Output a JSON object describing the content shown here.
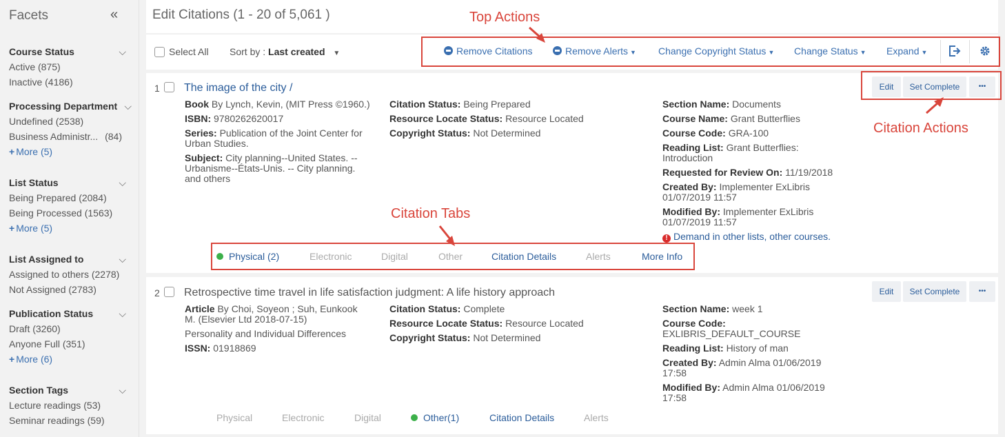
{
  "sidebar": {
    "title": "Facets",
    "facets": [
      {
        "title": "Course Status",
        "items": [
          {
            "label": "Active",
            "count": "(875)"
          },
          {
            "label": "Inactive",
            "count": "(4186)"
          }
        ]
      },
      {
        "title": "Processing Department",
        "items": [
          {
            "label": "Undefined",
            "count": "(2538)"
          },
          {
            "label": "Business Administr...",
            "count": "(84)"
          }
        ],
        "more": "More (5)"
      },
      {
        "title": "List Status",
        "items": [
          {
            "label": "Being Prepared",
            "count": "(2084)"
          },
          {
            "label": "Being Processed",
            "count": "(1563)"
          }
        ],
        "more": "More (5)"
      },
      {
        "title": "List Assigned to",
        "items": [
          {
            "label": "Assigned to others",
            "count": "(2278)"
          },
          {
            "label": "Not Assigned",
            "count": "(2783)"
          }
        ]
      },
      {
        "title": "Publication Status",
        "items": [
          {
            "label": "Draft",
            "count": "(3260)"
          },
          {
            "label": "Anyone Full",
            "count": "(351)"
          }
        ],
        "more": "More (6)"
      },
      {
        "title": "Section Tags",
        "items": [
          {
            "label": "Lecture readings",
            "count": "(53)"
          },
          {
            "label": "Seminar readings",
            "count": "(59)"
          }
        ]
      }
    ]
  },
  "header": {
    "title": "Edit Citations (1 - 20 of 5,061 )"
  },
  "toolbar": {
    "select_all": "Select All",
    "sort_prefix": "Sort by :",
    "sort_value": "Last created",
    "actions": {
      "remove_citations": "Remove Citations",
      "remove_alerts": "Remove Alerts",
      "change_copyright": "Change Copyright Status",
      "change_status": "Change Status",
      "expand": "Expand"
    }
  },
  "annotations": {
    "top_actions": "Top Actions",
    "citation_actions": "Citation Actions",
    "citation_tabs": "Citation Tabs"
  },
  "citations": [
    {
      "num": "1",
      "title": "The image of the city /",
      "left": {
        "type": "Book",
        "by": "By Lynch, Kevin, (MIT Press ©1960.)",
        "isbn_label": "ISBN:",
        "isbn": "9780262620017",
        "series_label": "Series:",
        "series": "Publication of the Joint Center for Urban Studies.",
        "subject_label": "Subject:",
        "subject": "City planning--United States. -- Urbanisme--États-Unis. -- City planning.",
        "others": "and others"
      },
      "middle": {
        "status_label": "Citation Status:",
        "status": "Being Prepared",
        "rls_label": "Resource Locate Status:",
        "rls": "Resource Located",
        "copyright_label": "Copyright Status:",
        "copyright": "Not Determined"
      },
      "right": {
        "section_label": "Section Name:",
        "section": "Documents",
        "course_label": "Course Name:",
        "course": "Grant Butterflies",
        "code_label": "Course Code:",
        "code": "GRA-100",
        "list_label": "Reading List:",
        "list": "Grant Butterflies: Introduction",
        "review_label": "Requested for Review On:",
        "review": "11/19/2018",
        "created_label": "Created By:",
        "created": "Implementer ExLibris 01/07/2019 11:57",
        "modified_label": "Modified By:",
        "modified": "Implementer ExLibris 01/07/2019 11:57",
        "demand": "Demand in other lists, other courses."
      },
      "buttons": {
        "edit": "Edit",
        "complete": "Set Complete",
        "more": "•••"
      },
      "tabs": [
        "Physical (2)",
        "Electronic",
        "Digital",
        "Other",
        "Citation Details",
        "Alerts",
        "More Info"
      ]
    },
    {
      "num": "2",
      "title": "Retrospective time travel in life satisfaction judgment: A life history approach",
      "left": {
        "type": "Article",
        "by": "By Choi, Soyeon ; Suh, Eunkook M. (Elsevier Ltd 2018-07-15)",
        "journal": "Personality and Individual Differences",
        "issn_label": "ISSN:",
        "issn": "01918869"
      },
      "middle": {
        "status_label": "Citation Status:",
        "status": "Complete",
        "rls_label": "Resource Locate Status:",
        "rls": "Resource Located",
        "copyright_label": "Copyright Status:",
        "copyright": "Not Determined"
      },
      "right": {
        "section_label": "Section Name:",
        "section": "week 1",
        "code_label": "Course Code:",
        "code": "EXLIBRIS_DEFAULT_COURSE",
        "list_label": "Reading List:",
        "list": "History of man",
        "created_label": "Created By:",
        "created": "Admin Alma 01/06/2019 17:58",
        "modified_label": "Modified By:",
        "modified": "Admin Alma 01/06/2019 17:58"
      },
      "buttons": {
        "edit": "Edit",
        "complete": "Set Complete",
        "more": "•••"
      },
      "tabs": [
        "Physical",
        "Electronic",
        "Digital",
        "Other(1)",
        "Citation Details",
        "Alerts"
      ]
    }
  ],
  "colors": {
    "accent": "#3a6fb0",
    "annotation": "#d9453b",
    "status_dot": "#3cb04a"
  }
}
